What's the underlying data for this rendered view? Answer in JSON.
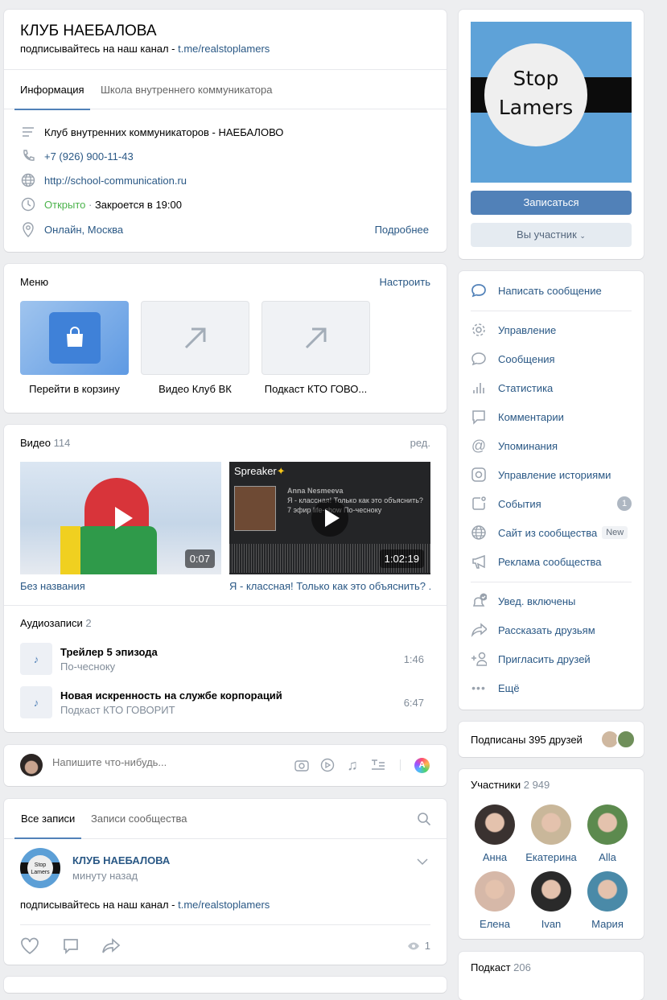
{
  "group": {
    "name": "КЛУБ НАЕБАЛОВА",
    "status": "подписывайтесь на наш канал - ",
    "status_link": "t.me/realstoplamers"
  },
  "info_tabs": [
    {
      "label": "Информация"
    },
    {
      "label": "Школа внутреннего коммуникатора"
    }
  ],
  "info": {
    "description": "Клуб внутренних коммуникаторов - НАЕБАЛОВО",
    "phone": "+7 (926) 900-11-43",
    "site": "http://school-communication.ru",
    "open": "Открыто",
    "sep": " · ",
    "closes": "Закроется в 19:00",
    "location": "Онлайн, Москва",
    "more": "Подробнее"
  },
  "menu": {
    "title": "Меню",
    "configure": "Настроить",
    "items": [
      {
        "label": "Перейти в корзину"
      },
      {
        "label": "Видео Клуб ВК"
      },
      {
        "label": "Подкаст КТО ГОВО..."
      }
    ]
  },
  "videos": {
    "title": "Видео",
    "count": "114",
    "edit": "ред.",
    "items": [
      {
        "title": "Без названия",
        "duration": "0:07"
      },
      {
        "title": "Я - классная! Только как это объяснить? ...",
        "duration": "1:02:19",
        "brand": "Spreaker",
        "author": "Anna Nesmeeva",
        "desc": "Я - классная! Только как это объяснить? 7 эфир life-show По-чесноку"
      }
    ]
  },
  "audios": {
    "title": "Аудиозаписи",
    "count": "2",
    "items": [
      {
        "title": "Трейлер 5 эпизода",
        "artist": "По-чесноку",
        "duration": "1:46"
      },
      {
        "title": "Новая искренность на службе корпораций",
        "artist": "Подкаст КТО ГОВОРИТ",
        "duration": "6:47"
      }
    ]
  },
  "composer": {
    "placeholder": "Напишите что-нибудь..."
  },
  "wall": {
    "tabs": [
      {
        "label": "Все записи"
      },
      {
        "label": "Записи сообщества"
      }
    ],
    "post": {
      "author": "КЛУБ НАЕБАЛОВА",
      "time": "минуту назад",
      "text": "подписывайтесь на наш канал - ",
      "link": "t.me/realstoplamers",
      "views": "1"
    }
  },
  "cover": {
    "line1": "Stop",
    "line2": "Lamers",
    "join": "Записаться",
    "member": "Вы участник"
  },
  "actions": {
    "primary": "Написать сообщение",
    "items": [
      {
        "label": "Управление"
      },
      {
        "label": "Сообщения"
      },
      {
        "label": "Статистика"
      },
      {
        "label": "Комментарии"
      },
      {
        "label": "Упоминания"
      },
      {
        "label": "Управление историями"
      },
      {
        "label": "События",
        "badge": "1"
      },
      {
        "label": "Сайт из сообщества",
        "badge": "New"
      },
      {
        "label": "Реклама сообщества"
      }
    ],
    "secondary": [
      {
        "label": "Увед. включены"
      },
      {
        "label": "Рассказать друзьям"
      },
      {
        "label": "Пригласить друзей"
      },
      {
        "label": "Ещё"
      }
    ]
  },
  "friends": {
    "label": "Подписаны 395 друзей"
  },
  "members": {
    "title": "Участники",
    "count": "2 949",
    "items": [
      {
        "name": "Анна",
        "color": "#3a3230"
      },
      {
        "name": "Екатерина",
        "color": "#c9b79a"
      },
      {
        "name": "Alla",
        "color": "#5c8a4e"
      },
      {
        "name": "Елена",
        "color": "#d6b8a8"
      },
      {
        "name": "Ivan",
        "color": "#2a2a2a"
      },
      {
        "name": "Мария",
        "color": "#4a8aa8"
      }
    ]
  },
  "podcast": {
    "title": "Подкаст",
    "count": "206"
  }
}
